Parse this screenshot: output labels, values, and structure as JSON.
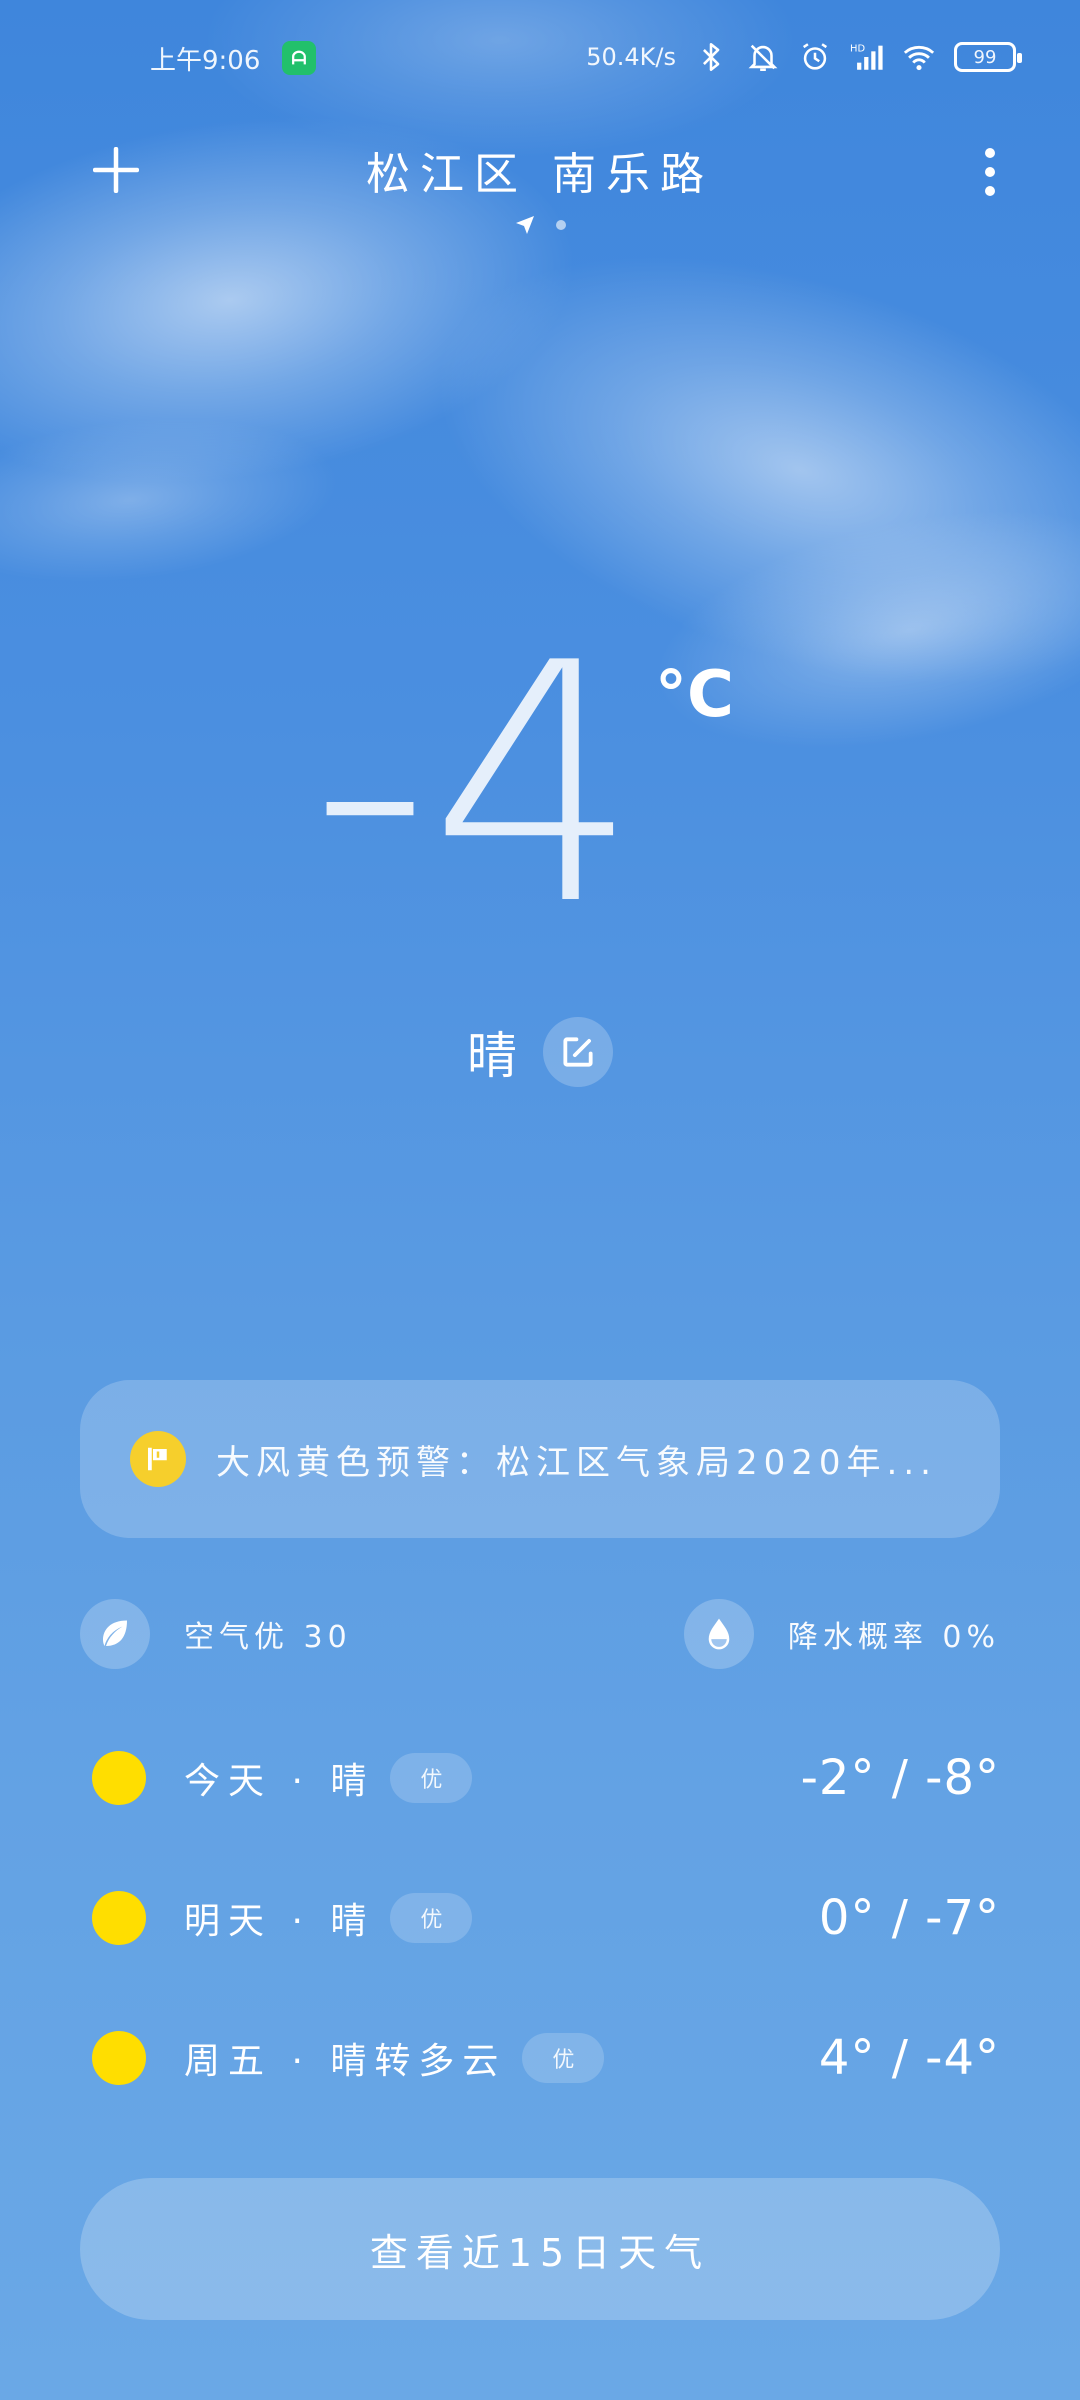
{
  "status_bar": {
    "time": "上午9:06",
    "app_badge": "ᗩ",
    "network_speed": "50.4K/s",
    "battery": "99",
    "icons": [
      "bluetooth-icon",
      "mute-bell-icon",
      "alarm-icon",
      "hd-signal-icon",
      "wifi-icon",
      "battery-icon"
    ]
  },
  "header": {
    "city": "松江区 南乐路",
    "add_icon": "plus-icon",
    "more_icon": "more-vertical-icon"
  },
  "current": {
    "temperature": "-4",
    "unit": "°C",
    "condition": "晴"
  },
  "alert": {
    "text": "大风黄色预警：松江区气象局2020年..."
  },
  "info": {
    "air_quality": "空气优 30",
    "precipitation": "降水概率 0%"
  },
  "forecast": [
    {
      "day": "今天 · 晴",
      "aqi": "优",
      "temps": "-2° / -8°",
      "icon": "sun-icon"
    },
    {
      "day": "明天 · 晴",
      "aqi": "优",
      "temps": "0° / -7°",
      "icon": "sun-icon"
    },
    {
      "day": "周五 · 晴转多云",
      "aqi": "优",
      "temps": "4° / -4°",
      "icon": "sun-icon"
    }
  ],
  "fifteen_day_button": "查看近15日天气",
  "colors": {
    "sky_top": "#3f86dc",
    "sky_bottom": "#6aa8e6",
    "sun": "#ffde00",
    "alert_badge": "#f6cf2c",
    "app_badge": "#22c06b"
  }
}
